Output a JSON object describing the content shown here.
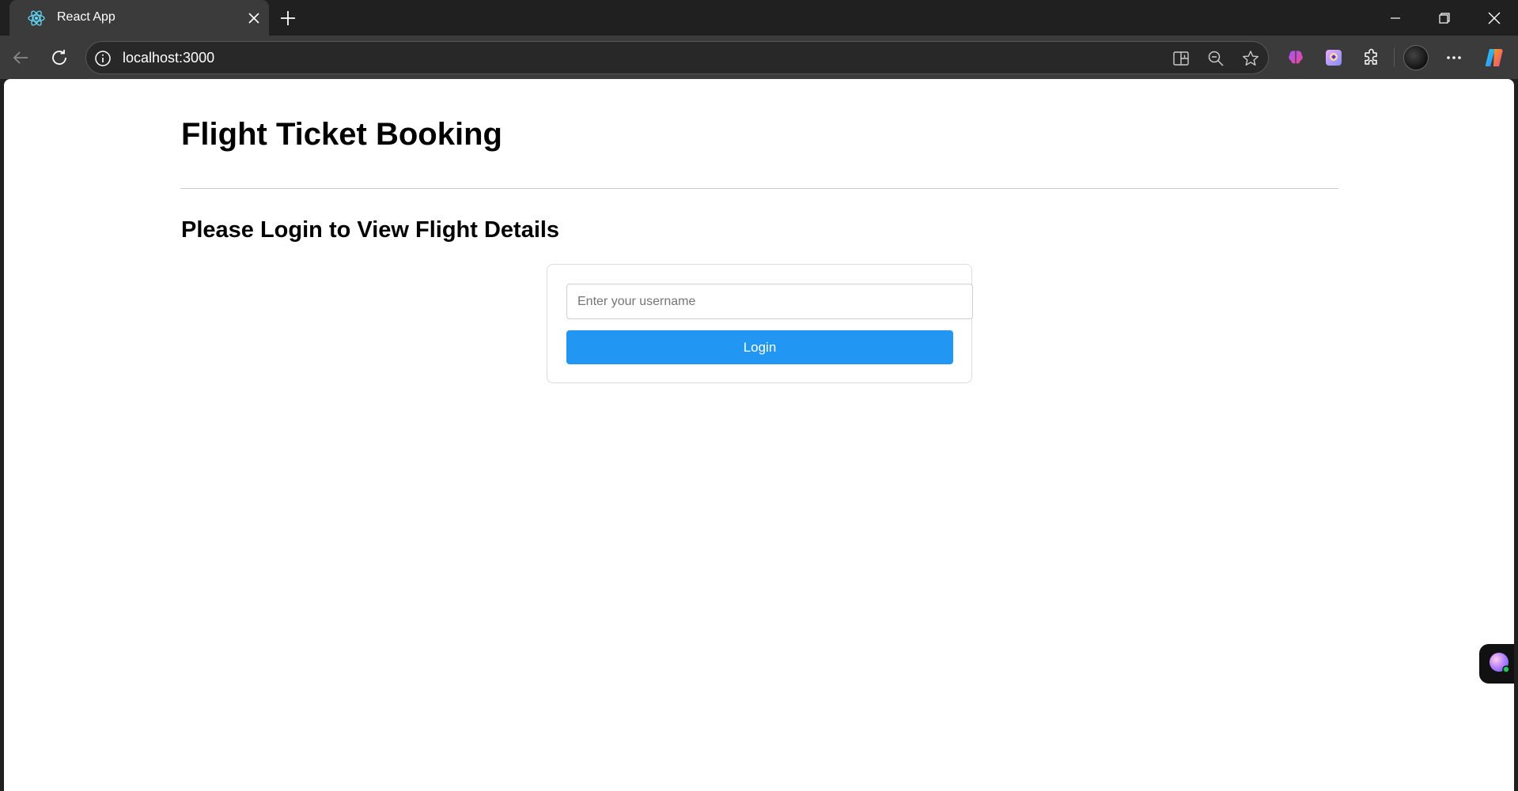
{
  "browser": {
    "tab": {
      "title": "React App",
      "favicon": "react-icon"
    },
    "address_bar": {
      "url": "localhost:3000"
    },
    "icons": {
      "back": "back-arrow-icon",
      "reload": "reload-icon",
      "site_info": "info-icon",
      "split_screen": "split-screen-icon",
      "zoom": "zoom-out-icon",
      "favorite": "star-icon",
      "extensions": "puzzle-icon",
      "menu": "more-icon",
      "copilot": "copilot-icon"
    }
  },
  "page": {
    "title": "Flight Ticket Booking",
    "section_title": "Please Login to View Flight Details",
    "login": {
      "username_placeholder": "Enter your username",
      "username_value": "",
      "button_label": "Login"
    }
  },
  "colors": {
    "accent": "#2196f3",
    "chrome_dark": "#202020",
    "toolbar": "#3b3b3b"
  }
}
